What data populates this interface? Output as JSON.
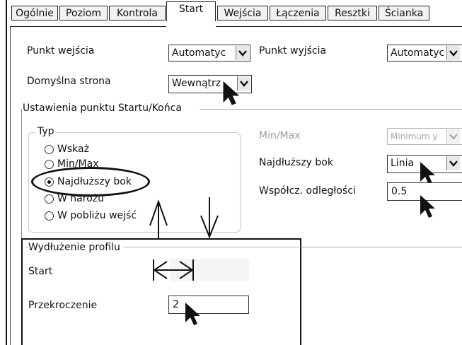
{
  "tabs": [
    {
      "label": "Ogólnie",
      "active": false
    },
    {
      "label": "Poziom",
      "active": false
    },
    {
      "label": "Kontrola",
      "active": false
    },
    {
      "label": "Start",
      "active": true
    },
    {
      "label": "Wejścia",
      "active": false
    },
    {
      "label": "Łączenia",
      "active": false
    },
    {
      "label": "Resztki",
      "active": false
    },
    {
      "label": "Ścianka",
      "active": false
    }
  ],
  "entry": {
    "label": "Punkt wejścia",
    "value": "Automatyc"
  },
  "exit": {
    "label": "Punkt wyjścia",
    "value": "Automatyc"
  },
  "side": {
    "label": "Domyślna strona",
    "value": "Wewnątrz"
  },
  "start_end_section": {
    "title": "Ustawienia punktu Startu/Końca"
  },
  "type_group": {
    "title": "Typ",
    "options": [
      {
        "label": "Wskaż",
        "selected": false
      },
      {
        "label": "Min/Max",
        "selected": false
      },
      {
        "label": "Najdłuższy bok",
        "selected": true
      },
      {
        "label": "W narożu",
        "selected": false
      },
      {
        "label": "W pobliżu wejść",
        "selected": false
      }
    ]
  },
  "minmax": {
    "label": "Min/Max",
    "value": "Minimum y",
    "disabled": true
  },
  "longest_side": {
    "label": "Najdłuższy bok",
    "value": "Linia"
  },
  "distance_factor": {
    "label": "Współcz. odległości",
    "value": "0.5"
  },
  "extension": {
    "title": "Wydłużenie profilu",
    "start_label": "Start",
    "overrun_label": "Przekroczenie",
    "overrun_value": "2"
  },
  "colors": {
    "frame": "#111111",
    "muted": "#9b9b9b",
    "tab_bg": "#f2f2f2"
  },
  "icons": [
    "dropdown-arrow-icon",
    "mouse-cursor-icon",
    "double-arrow-icon",
    "pointer-arrow-icon"
  ]
}
